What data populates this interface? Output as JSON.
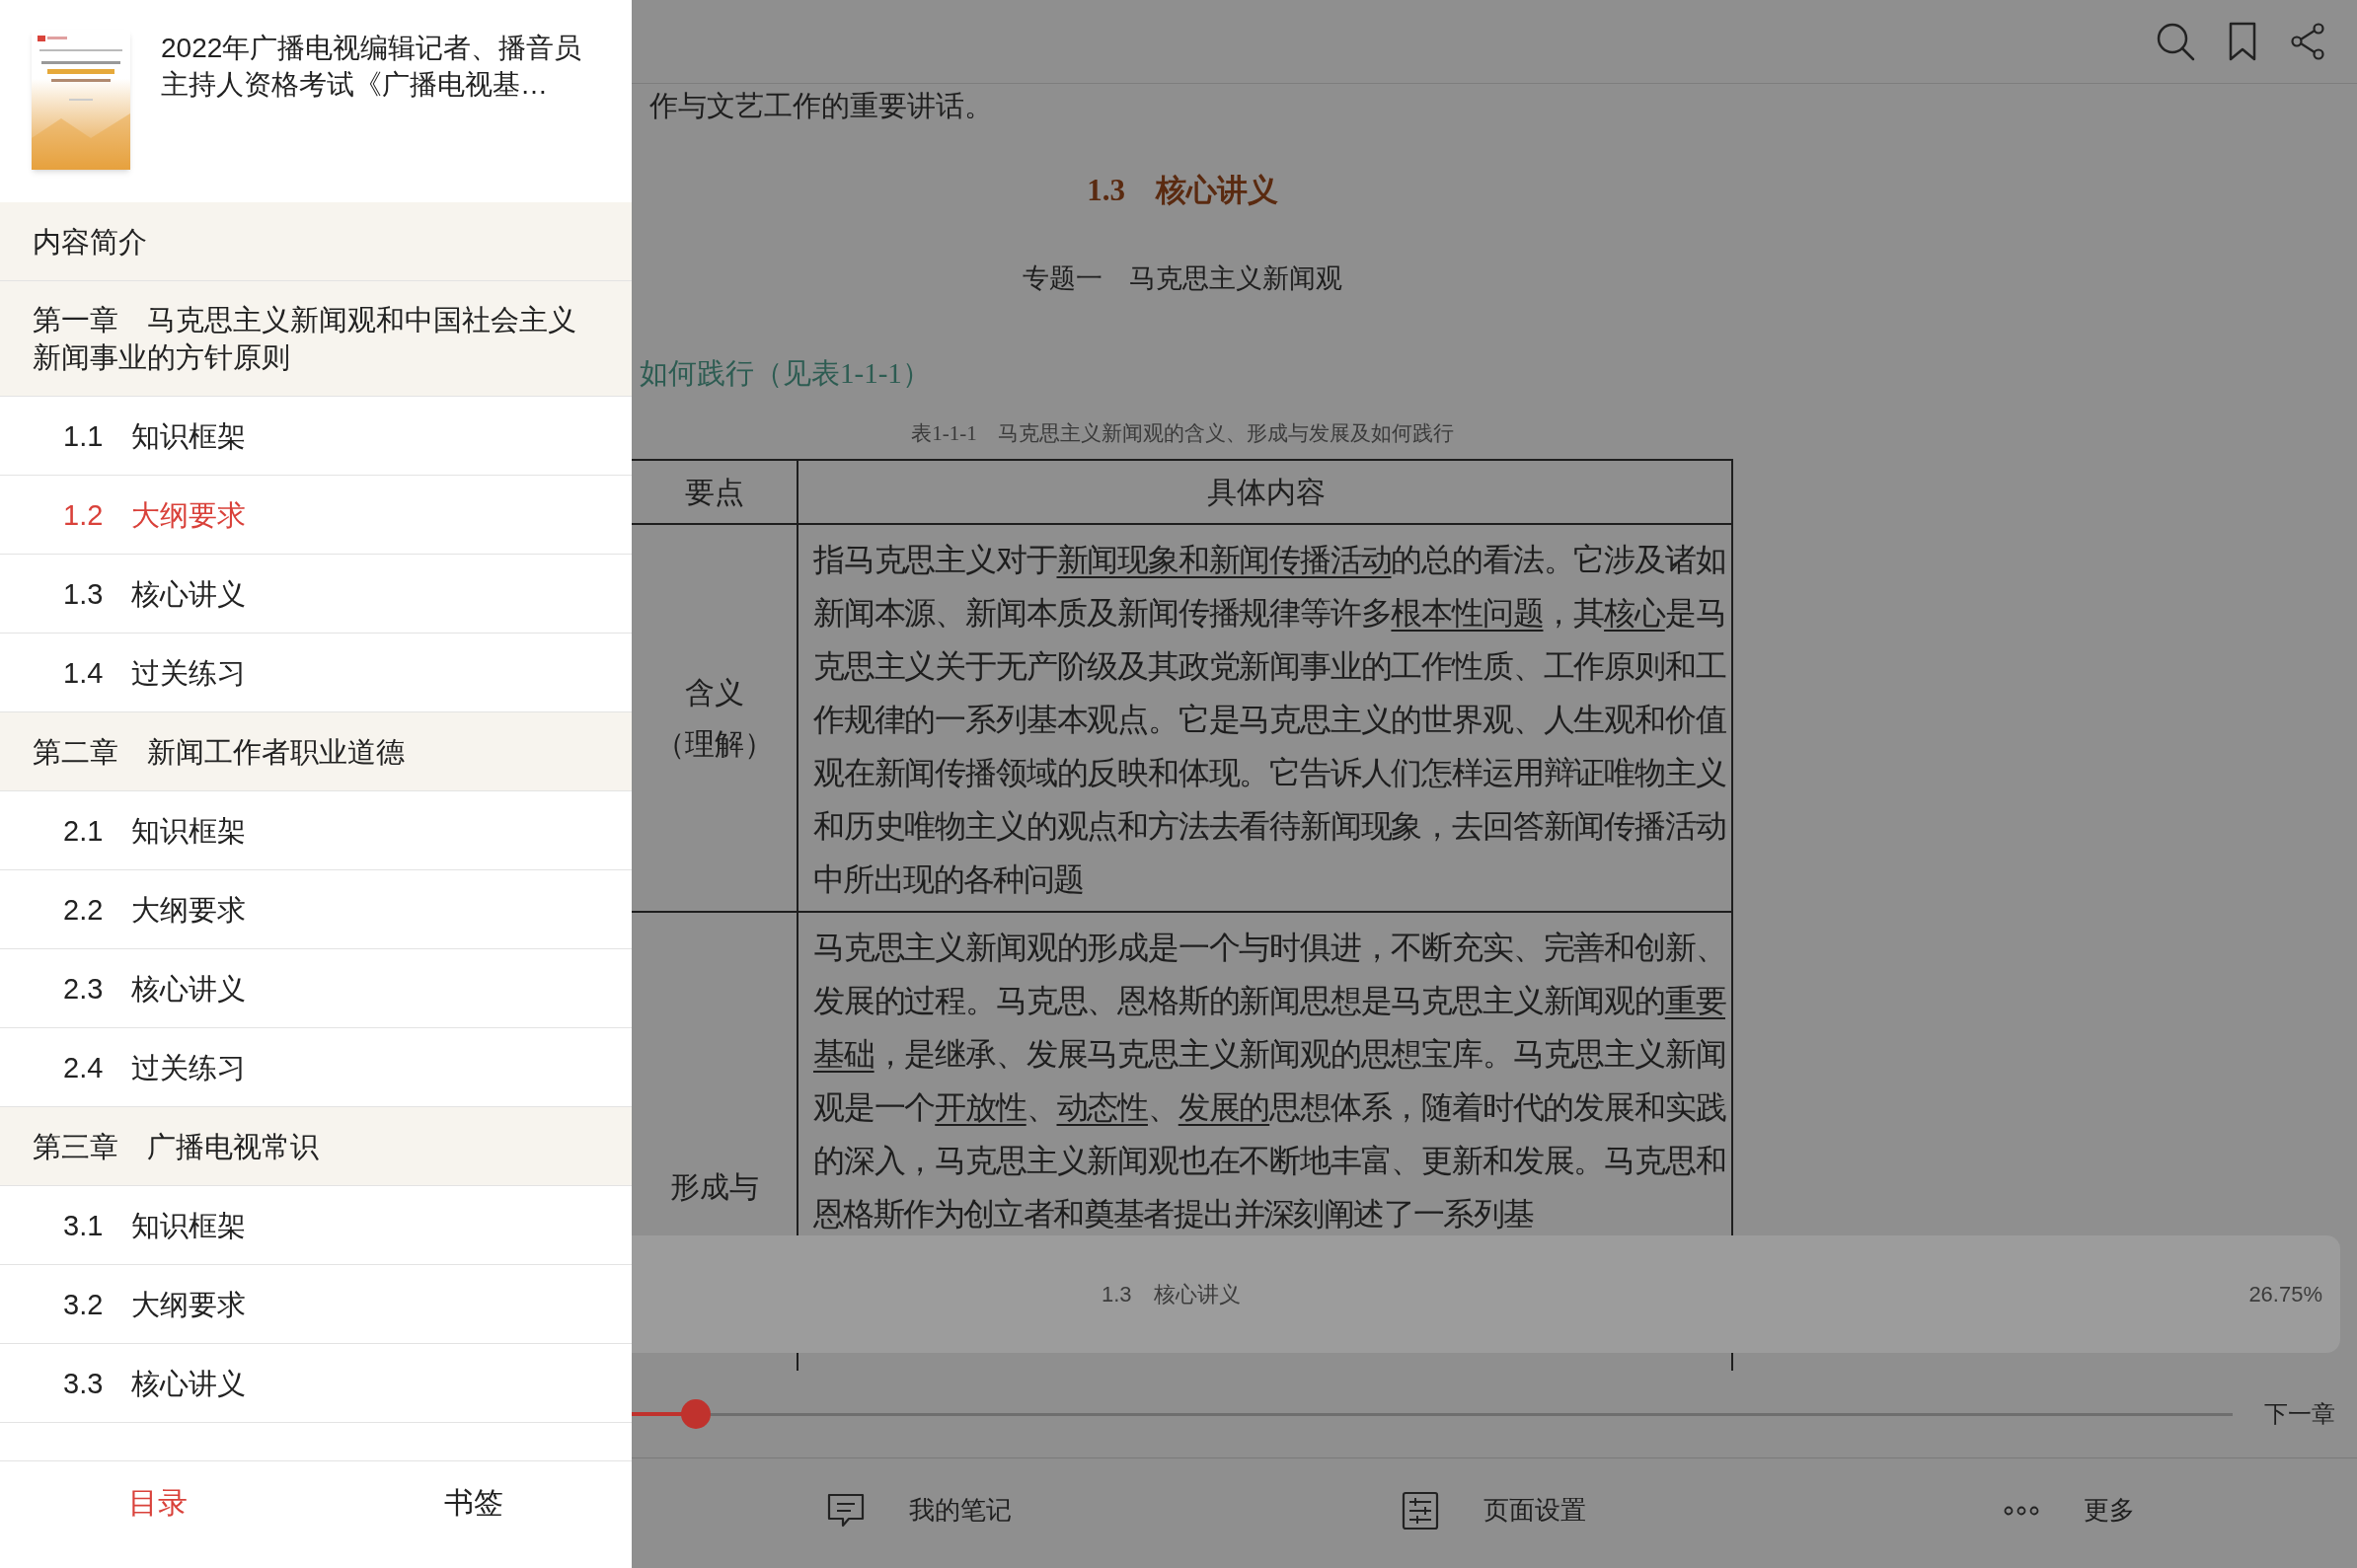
{
  "book": {
    "title": "2022年广播电视编辑记者、播音员主持人资格考试《广播电视基…"
  },
  "toc": [
    {
      "label": "内容简介",
      "selected": false
    },
    {
      "label": "第一章　马克思主义新闻观和中国社会主义新闻事业的方针原则",
      "selected": false,
      "children": [
        {
          "label": "1.1　知识框架",
          "selected": false
        },
        {
          "label": "1.2　大纲要求",
          "selected": true
        },
        {
          "label": "1.3　核心讲义",
          "selected": false
        },
        {
          "label": "1.4　过关练习",
          "selected": false
        }
      ]
    },
    {
      "label": "第二章　新闻工作者职业道德",
      "selected": false,
      "children": [
        {
          "label": "2.1　知识框架",
          "selected": false
        },
        {
          "label": "2.2　大纲要求",
          "selected": false
        },
        {
          "label": "2.3　核心讲义",
          "selected": false
        },
        {
          "label": "2.4　过关练习",
          "selected": false
        }
      ]
    },
    {
      "label": "第三章　广播电视常识",
      "selected": false,
      "children": [
        {
          "label": "3.1　知识框架",
          "selected": false
        },
        {
          "label": "3.2　大纲要求",
          "selected": false
        },
        {
          "label": "3.3　核心讲义",
          "selected": false
        }
      ]
    }
  ],
  "sidebar_tabs": [
    {
      "label": "目录",
      "selected": true
    },
    {
      "label": "书签",
      "selected": false
    }
  ],
  "page": {
    "lead_text": "作与文艺工作的重要讲话。",
    "section_heading": "1.3　核心讲义",
    "topic": "专题一　马克思主义新闻观",
    "subheading": "如何践行（见表1-1-1）",
    "table_caption": "表1-1-1　马克思主义新闻观的含义、形成与发展及如何践行",
    "table": {
      "columns": [
        "要点",
        "具体内容"
      ],
      "rows": [
        {
          "label_lines": [
            "含义",
            "（理解）"
          ],
          "content": [
            {
              "text": "指马克思主义对于",
              "underline": false
            },
            {
              "text": "新闻现象和新闻传播活动",
              "underline": true
            },
            {
              "text": "的总的看法。它涉及诸如新闻本源、新闻本质及新闻传播规律等许多",
              "underline": false
            },
            {
              "text": "根本性问题",
              "underline": true
            },
            {
              "text": "，其",
              "underline": false
            },
            {
              "text": "核心",
              "underline": true
            },
            {
              "text": "是马克思主义关于无产阶级及其政党新闻事业的工作性质、工作原则和工作规律的一系列基本观点。它是马克思主义的世界观、人生观和价值观在新闻传播领域的反映和体现。它告诉人们怎样运用辩证唯物主义和历史唯物主义的观点和方法去看待新闻现象，去回答新闻传播活动中所出现的各种问题",
              "underline": false
            }
          ]
        },
        {
          "label_lines": [
            "形成与"
          ],
          "content": [
            {
              "text": "马克思主义新闻观的形成是一个与时俱进，不断充实、完善和创新、发展的过程。马克思、恩格斯的新闻思想是马克思主义新闻观的",
              "underline": false
            },
            {
              "text": "重要基础",
              "underline": true
            },
            {
              "text": "，是继承、发展马克思主义新闻观的思想宝库。马克思主义新闻观是一个",
              "underline": false
            },
            {
              "text": "开放性",
              "underline": true
            },
            {
              "text": "、",
              "underline": false
            },
            {
              "text": "动态性",
              "underline": true
            },
            {
              "text": "、",
              "underline": false
            },
            {
              "text": "发展的",
              "underline": true
            },
            {
              "text": "思想体系，随着时代的发展和实践的深入，马克思主义新闻观也在不断地丰富、更新和发展。马克思和恩格斯作为创立者和奠基者提出并深刻阐述了一系列基",
              "underline": false
            }
          ]
        }
      ]
    }
  },
  "progress_popup": {
    "chapter": "1.3　核心讲义",
    "percent": "26.75%"
  },
  "slider": {
    "level": 0.04,
    "next_label": "下一章"
  },
  "bottom_toolbar": [
    {
      "kind": "notes",
      "label": "我的笔记"
    },
    {
      "kind": "settings",
      "label": "页面设置"
    },
    {
      "kind": "more",
      "label": "更多"
    }
  ]
}
